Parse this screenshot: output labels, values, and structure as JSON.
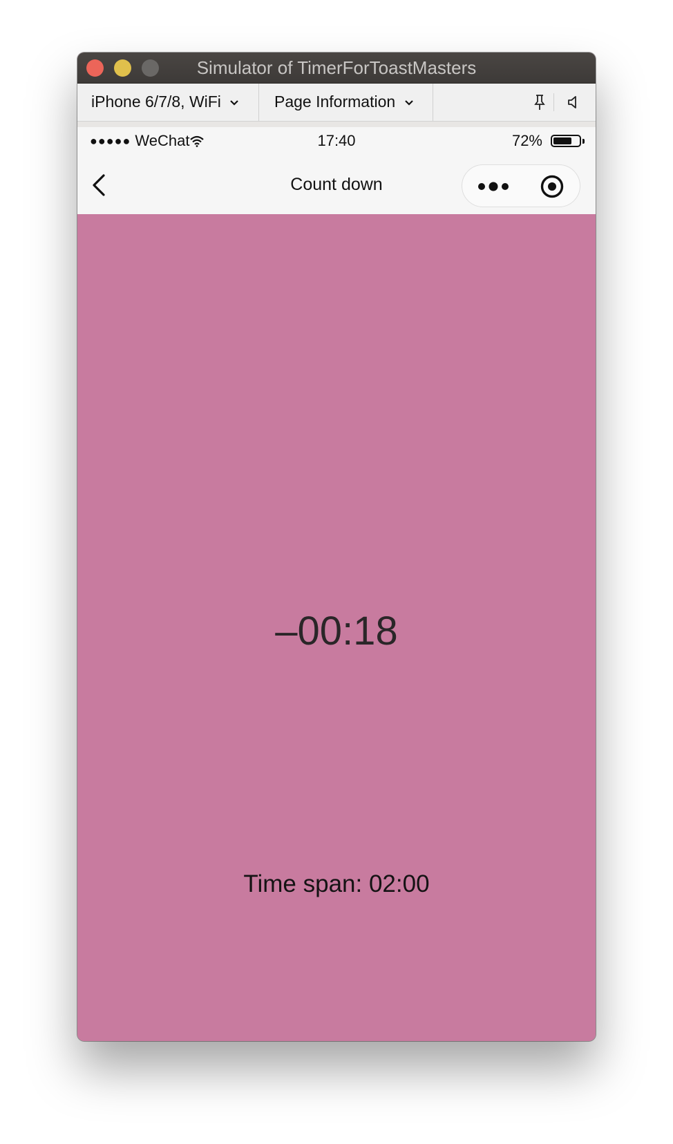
{
  "window": {
    "title": "Simulator of TimerForToastMasters"
  },
  "toolbar": {
    "device": "iPhone 6/7/8, WiFi",
    "page_info": "Page Information"
  },
  "statusbar": {
    "signal_dots": "●●●●●",
    "carrier": "WeChat",
    "time": "17:40",
    "battery_percent": "72%",
    "battery_level": 0.72
  },
  "navbar": {
    "title": "Count down"
  },
  "timer": {
    "countdown": "–00:18",
    "time_span": "Time span: 02:00"
  },
  "colors": {
    "background": "#c87b9f"
  },
  "icons": [
    "chevron-down-icon",
    "pin-icon",
    "speaker-icon",
    "wifi-icon",
    "battery-icon",
    "back-arrow-icon",
    "more-icon",
    "target-icon"
  ]
}
